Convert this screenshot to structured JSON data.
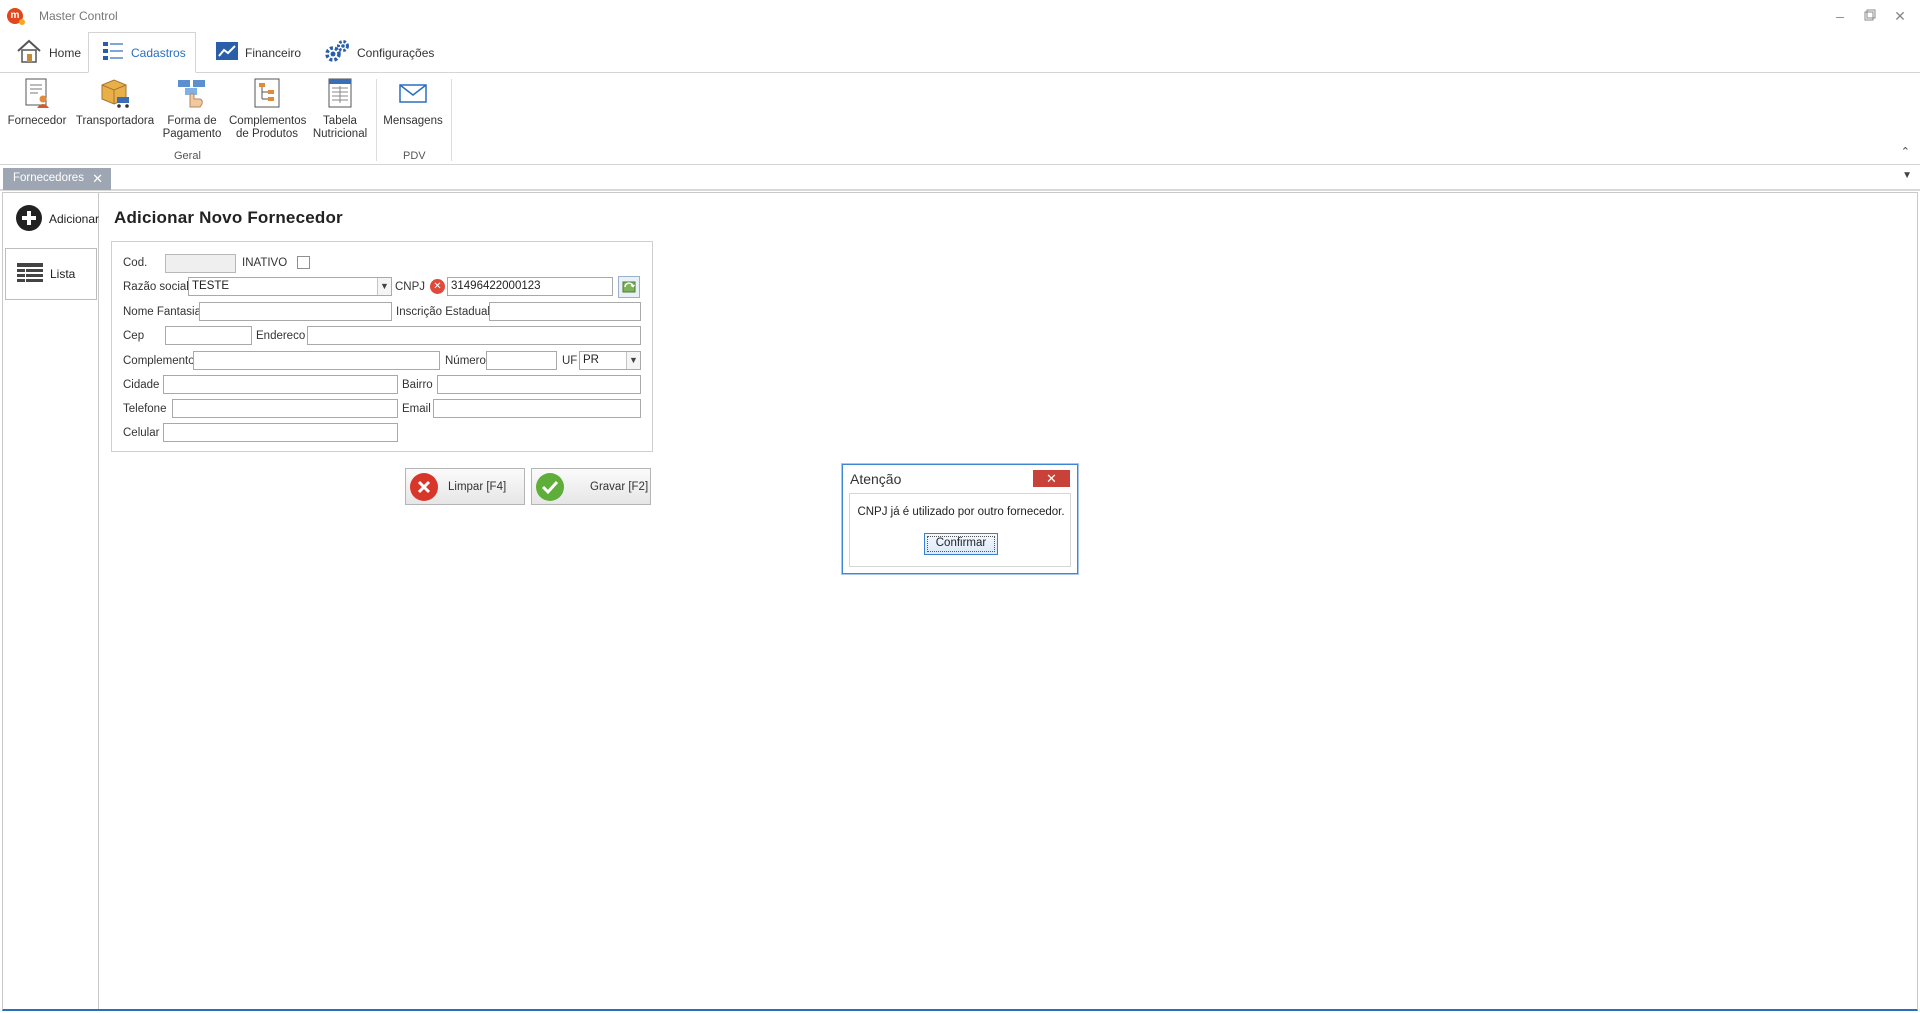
{
  "window": {
    "title": "Master Control"
  },
  "ribbon": {
    "tabs": [
      {
        "label": "Home"
      },
      {
        "label": "Cadastros"
      },
      {
        "label": "Financeiro"
      },
      {
        "label": "Configurações"
      }
    ],
    "buttons": {
      "fornecedor": "Fornecedor",
      "transportadora": "Transportadora",
      "forma_pagamento_1": "Forma de",
      "forma_pagamento_2": "Pagamento",
      "complementos_1": "Complementos",
      "complementos_2": "de Produtos",
      "tabela_1": "Tabela",
      "tabela_2": "Nutricional",
      "mensagens": "Mensagens"
    },
    "groups": {
      "geral": "Geral",
      "pdv": "PDV"
    }
  },
  "doc_tab": {
    "label": "Fornecedores"
  },
  "left_nav": {
    "adicionar": "Adicionar",
    "lista": "Lista"
  },
  "form": {
    "title": "Adicionar Novo Fornecedor",
    "labels": {
      "cod": "Cod.",
      "inativo": "INATIVO",
      "razao_social": "Razão social",
      "cnpj": "CNPJ",
      "nome_fantasia": "Nome Fantasia",
      "inscricao_estadual": "Inscrição Estadual",
      "cep": "Cep",
      "endereco": "Endereco",
      "complemento": "Complemento",
      "numero": "Número",
      "uf": "UF",
      "cidade": "Cidade",
      "bairro": "Bairro",
      "telefone": "Telefone",
      "email": "Email",
      "celular": "Celular"
    },
    "values": {
      "cod": "",
      "razao_social": "TESTE",
      "cnpj": "31496422000123",
      "nome_fantasia": "",
      "inscricao_estadual": "",
      "cep": "",
      "endereco": "",
      "complemento": "",
      "numero": "",
      "uf": "PR",
      "cidade": "",
      "bairro": "",
      "telefone": "",
      "email": "",
      "celular": ""
    },
    "buttons": {
      "limpar": "Limpar [F4]",
      "gravar": "Gravar [F2]"
    }
  },
  "dialog": {
    "title": "Atenção",
    "close": "✕",
    "message": "CNPJ já é utilizado por outro fornecedor.",
    "confirm": "Confirmar"
  }
}
